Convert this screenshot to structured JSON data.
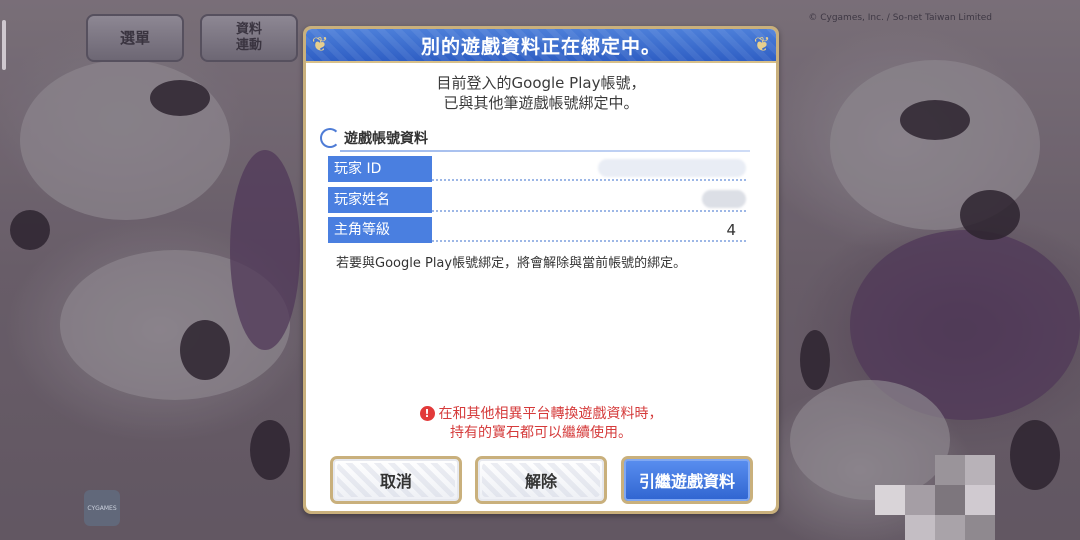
{
  "background": {
    "menu_button": "選單",
    "info_button_line1": "資料",
    "info_button_line2": "連動",
    "copyright": "© Cygames, Inc. / So-net Taiwan Limited",
    "corner_logo": "CYGAMES"
  },
  "dialog": {
    "title": "別的遊戲資料正在綁定中。",
    "description_line1": "目前登入的Google Play帳號，",
    "description_line2": "已與其他筆遊戲帳號綁定中。",
    "section_title": "遊戲帳號資料",
    "fields": [
      {
        "label": "玩家 ID",
        "value": ""
      },
      {
        "label": "玩家姓名",
        "value": ""
      },
      {
        "label": "主角等級",
        "value": "4"
      }
    ],
    "notice": "若要與Google Play帳號綁定，將會解除與當前帳號的綁定。",
    "warning_icon": "!",
    "warning_line1": "在和其他相異平台轉換遊戲資料時，",
    "warning_line2": "持有的寶石都可以繼續使用。",
    "buttons": {
      "cancel": "取消",
      "release": "解除",
      "inherit": "引繼遊戲資料"
    }
  },
  "colors": {
    "header_blue": "#3b6dd0",
    "tag_blue": "#4a7fe0",
    "border_gold": "#c9b07c",
    "warning_red": "#d53b3b"
  }
}
